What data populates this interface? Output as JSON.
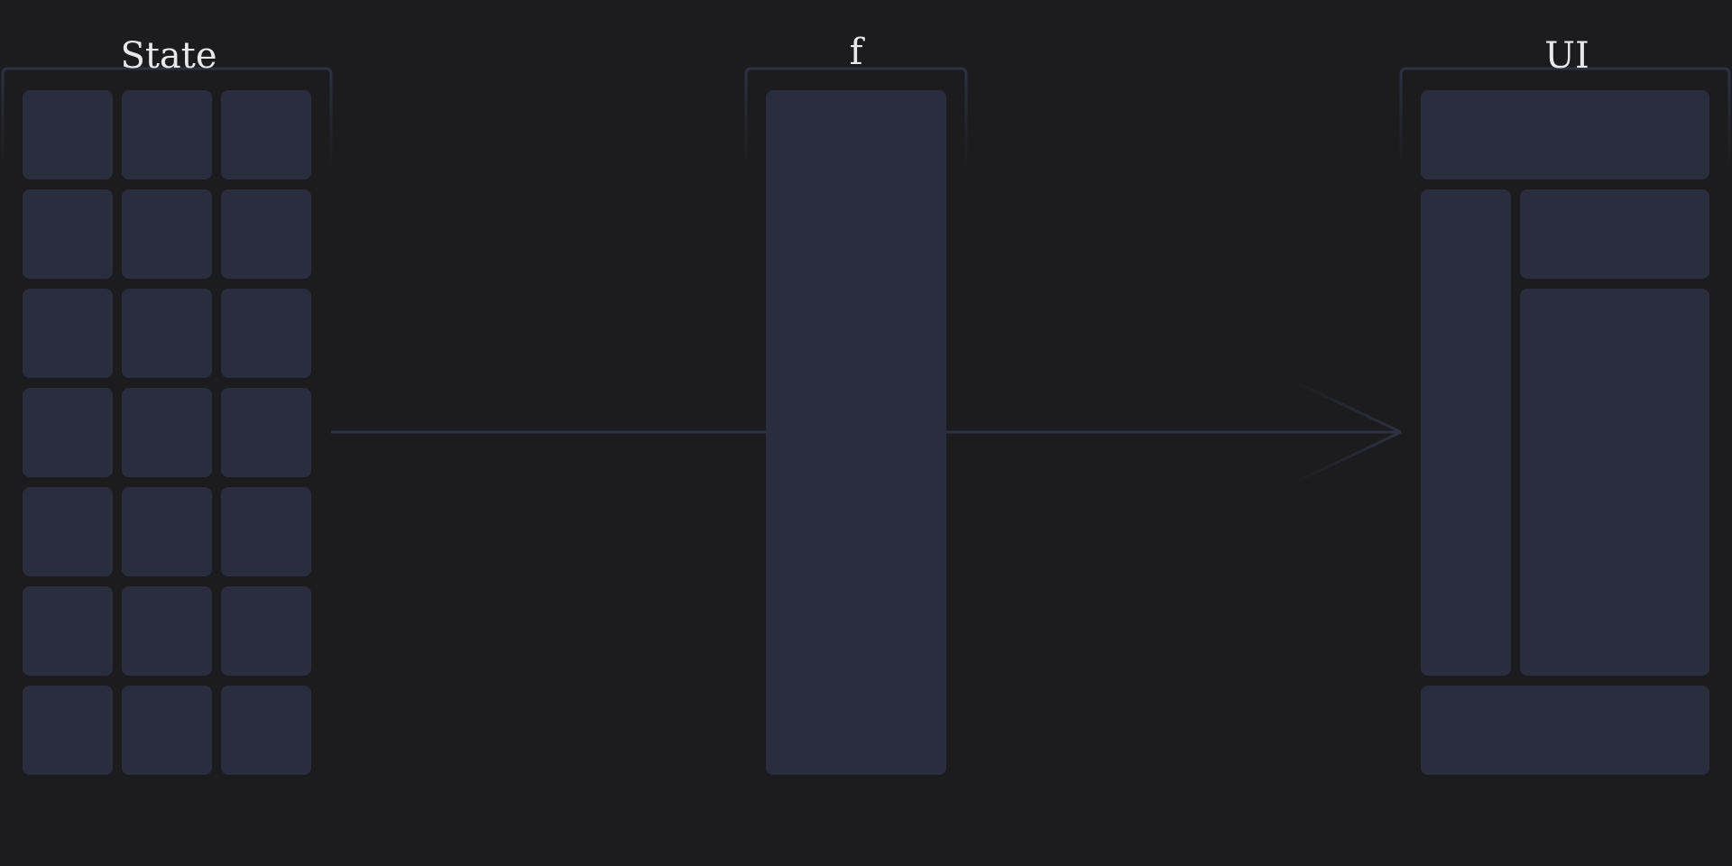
{
  "diagram": {
    "state_label": "State",
    "function_label": "f",
    "ui_label": "UI"
  },
  "colors": {
    "background": "#1c1c1e",
    "block": "#2a2d3e",
    "line": "#2e3142",
    "text": "#e8e8ec"
  }
}
